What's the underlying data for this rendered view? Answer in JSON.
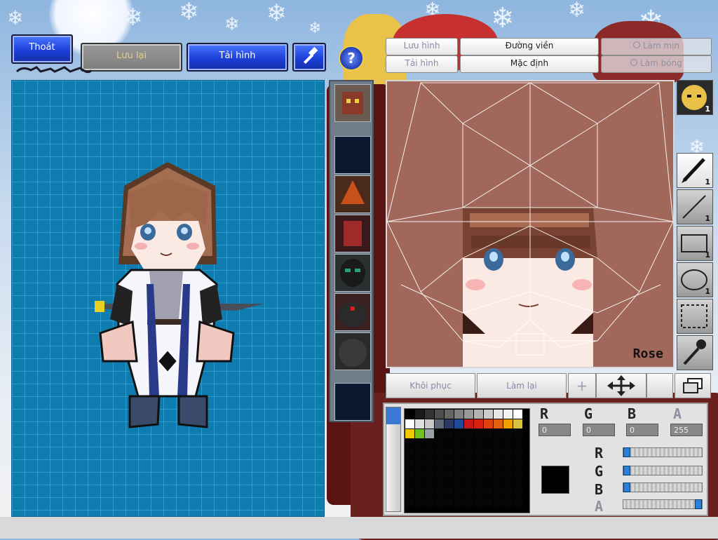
{
  "top_left": {
    "exit_label": "Thoát",
    "save_label": "Lưu lại",
    "load_image_label": "Tải hình",
    "hammer_icon": "hammer-icon"
  },
  "top_right": {
    "help_icon": "question-icon",
    "save_image_label": "Lưu hình",
    "border_label": "Đường viền",
    "smooth_label": "Làm mịn",
    "load_image_label": "Tải hình",
    "default_label": "Mặc định",
    "shade_label": "Làm bóng"
  },
  "face_canvas": {
    "tag": "Rose"
  },
  "tools": [
    {
      "name": "pen",
      "count": "1"
    },
    {
      "name": "line",
      "count": "1"
    },
    {
      "name": "rectangle",
      "count": "1"
    },
    {
      "name": "ellipse",
      "count": "1"
    },
    {
      "name": "selection",
      "count": ""
    },
    {
      "name": "eyedropper",
      "count": ""
    }
  ],
  "preview_count": "1",
  "actions": {
    "undo_label": "Khôi phục",
    "redo_label": "Làm lại"
  },
  "color": {
    "r_label": "R",
    "g_label": "G",
    "b_label": "B",
    "a_label": "A",
    "r_value": "0",
    "g_value": "0",
    "b_value": "0",
    "a_value": "255",
    "current": "#000000",
    "r_level": 0,
    "g_level": 0,
    "b_level": 0,
    "a_level": 1
  },
  "palette_row1": [
    "#000000",
    "#1a1a1a",
    "#333333",
    "#4d4d4d",
    "#666666",
    "#808080",
    "#999999",
    "#b3b3b3",
    "#cccccc",
    "#e6e6e6",
    "#f2f2f2",
    "#ffffff"
  ],
  "palette_row2": [
    "#ffffff",
    "#e0e0e0",
    "#c8c8c8",
    "#606878",
    "#2a3a60",
    "#1f4a9a",
    "#c81818",
    "#d82010",
    "#e04010",
    "#e06010",
    "#f0a000",
    "#d8c040"
  ],
  "palette_row3": [
    "#f0c800",
    "#70c020",
    "#9aa0a8"
  ]
}
